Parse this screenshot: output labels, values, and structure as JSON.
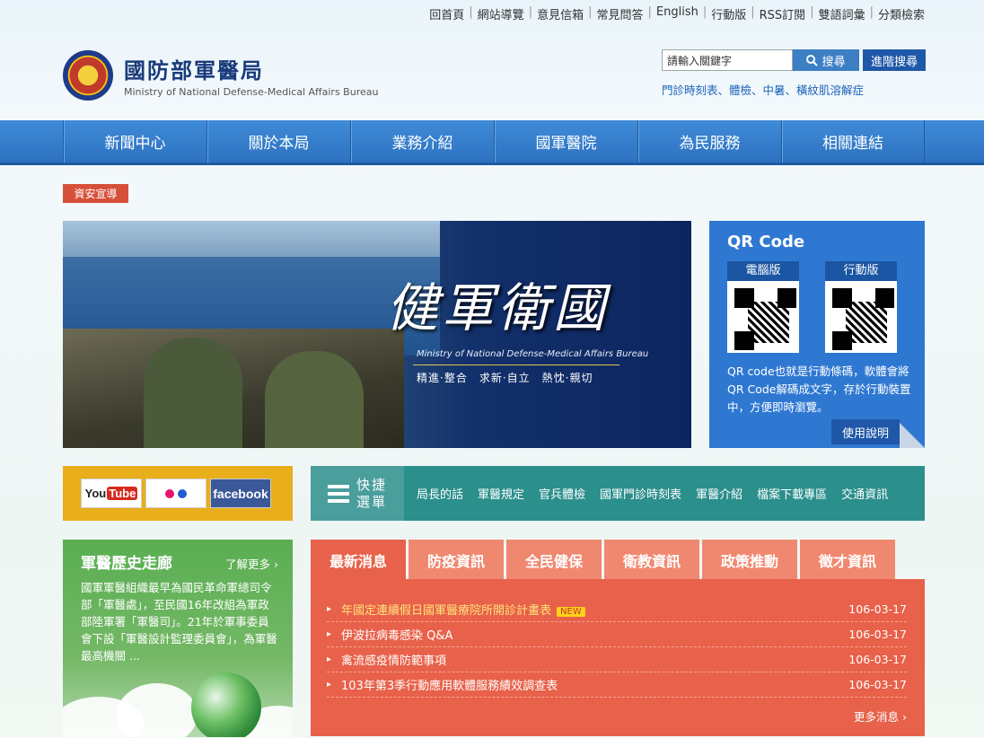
{
  "toplinks": [
    "回首頁",
    "網站導覽",
    "意見信箱",
    "常見問答",
    "English",
    "行動版",
    "RSS訂閱",
    "雙語詞彙",
    "分類檢索"
  ],
  "logo": {
    "cn": "國防部軍醫局",
    "en": "Ministry of National Defense-Medical Affairs Bureau"
  },
  "search": {
    "value": "請輸入關鍵字",
    "button": "搜尋",
    "advanced": "進階搜尋"
  },
  "hot_keywords": "門診時刻表、體檢、中暑、橫紋肌溶解症",
  "nav": [
    "新聞中心",
    "關於本局",
    "業務介紹",
    "國軍醫院",
    "為民服務",
    "相關連結"
  ],
  "security_badge": "資安宣導",
  "banner": {
    "title": "健軍衛國",
    "en": "Ministry of National Defense-Medical Affairs Bureau",
    "motto": "精進·整合　求新·自立　熱忱·親切"
  },
  "qr": {
    "title": "QR Code",
    "pc_label": "電腦版",
    "mobile_label": "行動版",
    "desc": "QR code也就是行動條碼，軟體會將QR Code解碼成文字，存於行動裝置中，方便即時瀏覽。",
    "more": "使用說明"
  },
  "social": {
    "youtube_a": "You",
    "youtube_b": "Tube",
    "facebook": "facebook",
    "flickr_colors": [
      "#e8136b",
      "#1f5fd1"
    ]
  },
  "quick": {
    "title": "快捷選單",
    "links": [
      "局長的話",
      "軍醫規定",
      "官兵體檢",
      "國軍門診時刻表",
      "軍醫介紹",
      "檔案下載專區",
      "交通資訊"
    ]
  },
  "history": {
    "title": "軍醫歷史走廊",
    "more": "了解更多 ›",
    "text": "國軍軍醫組織最早為國民革命軍總司令部「軍醫處」，至民國16年改組為軍政部陸軍署「軍醫司」。21年於軍事委員會下設「軍醫設計監理委員會」，為軍醫最高機關 ..."
  },
  "news": {
    "tabs": [
      "最新消息",
      "防疫資訊",
      "全民健保",
      "衛教資訊",
      "政策推動",
      "徵才資訊"
    ],
    "items": [
      {
        "title": "年國定連續假日國軍醫療院所開診計畫表",
        "date": "106-03-17",
        "badge": "NEW"
      },
      {
        "title": "伊波拉病毒感染 Q&A",
        "date": "106-03-17"
      },
      {
        "title": "禽流感疫情防範事項",
        "date": "106-03-17"
      },
      {
        "title": "103年第3季行動應用軟體服務績效調查表",
        "date": "106-03-17"
      }
    ],
    "more": "更多消息 ›"
  }
}
